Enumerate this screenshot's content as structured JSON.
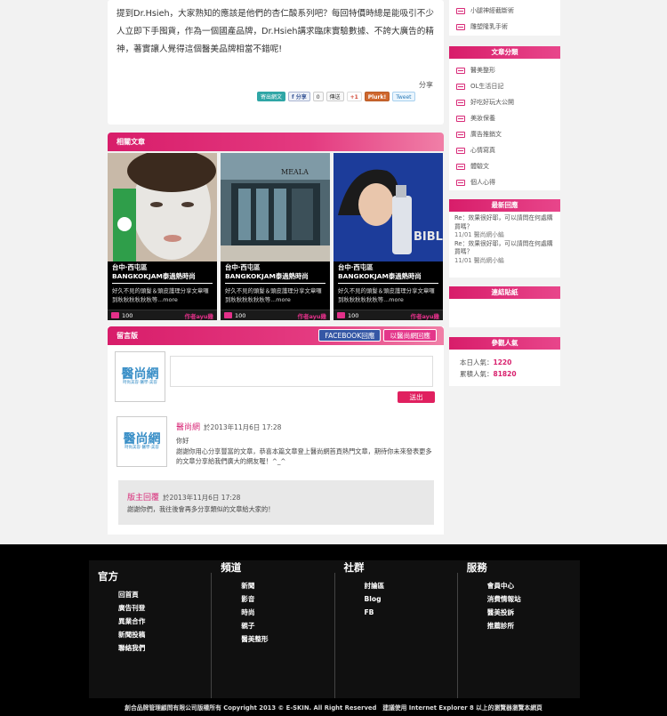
{
  "article": {
    "paragraph": "提到Dr.Hsieh，大家熟知的應該是他們的杏仁酸系列吧？每回特價時總是能吸引不少人立即下手囤貨，作為一個國產品牌，Dr.Hsieh講求臨床實驗數據、不誇大廣告的精神，著實讓人覺得這個醫美品牌相當不錯呢!",
    "share_label": "分享",
    "share_buttons": {
      "email": "寄出網文",
      "fb": "f 分享",
      "fb_count": "0",
      "send": "傳送",
      "gplus": "+1",
      "plurk": "Plurk!",
      "tweet": "Tweet"
    }
  },
  "related": {
    "title": "相關文章",
    "items": [
      {
        "loc": "台中‧西屯區",
        "name": "BANGKOKJAM泰過熱時尚",
        "excerpt": "好久不見的頭髮＆頭皮護理分享文章囉到秋秋秋秋秋秋等...more",
        "count": "100",
        "author": "作者ayu雞"
      },
      {
        "loc": "台中‧西屯區",
        "name": "BANGKOKJAM泰過熱時尚",
        "excerpt": "好久不見的頭髮＆頭皮護理分享文章囉到秋秋秋秋秋秋等...more",
        "count": "100",
        "author": "作者ayu雞"
      },
      {
        "loc": "台中‧西屯區",
        "name": "BANGKOKJAM泰過熱時尚",
        "excerpt": "好久不見的頭髮＆頭皮護理分享文章囉到秋秋秋秋秋秋等...more",
        "count": "100",
        "author": "作者ayu雞"
      }
    ],
    "img_texts": {
      "meala": "MEALA",
      "bible": "BIBLE"
    }
  },
  "comments": {
    "title": "留言版",
    "tab_fb": "FACEBOOK回應",
    "tab_site": "以醫尚網回應",
    "send": "送出",
    "avatar_logo": "醫尚網",
    "avatar_sub": "時尚美容‧醫學‧美容",
    "entry_name": "醫尚網",
    "entry_time": "於2013年11月6日 17:28",
    "entry_body": "你好\n謝謝你用心分享豐富的文章，恭喜本篇文章登上醫尚網首頁熱門文章，期待你未來發表更多的文章分享給我們廣大的網友喔！^_^",
    "reply_name": "版主回覆",
    "reply_time": "於2013年11月6日 17:28",
    "reply_body": "謝謝你們，我往後會再多分享類似的文章給大家的！"
  },
  "sidebar": {
    "top_items": [
      "小腿神經截斷術",
      "雕塑隆乳手術"
    ],
    "categories_title": "文章分類",
    "categories": [
      "醫美整形",
      "OL生活日記",
      "好吃好玩大公開",
      "美妝保養",
      "廣告推銷文",
      "心情寫真",
      "體驗文",
      "個人心得"
    ],
    "recent_title": "最新回應",
    "recent": [
      {
        "text": "Re：效果很好耶，可以請問在何處購買嗎？",
        "meta": "11/01 醫尚網小編"
      },
      {
        "text": "Re：效果很好耶，可以請問在何處購買嗎？",
        "meta": "11/01 醫尚網小編"
      }
    ],
    "links_title": "連結貼紙",
    "visitors_title": "參觀人氣",
    "today_label": "本日人氣：",
    "today": "1220",
    "total_label": "累積人氣：",
    "total": "81820"
  },
  "footer": {
    "cols": [
      {
        "head": "官方",
        "links": [
          "回首頁",
          "廣告刊登",
          "異業合作",
          "新聞投稿",
          "聯絡我們"
        ]
      },
      {
        "head": "頻道",
        "links": [
          "新聞",
          "影音",
          "時尚",
          "親子",
          "醫美整形"
        ]
      },
      {
        "head": "社群",
        "links": [
          "討論區",
          "Blog",
          "FB"
        ]
      },
      {
        "head": "服務",
        "links": [
          "會員中心",
          "消費情報站",
          "醫美投訴",
          "推薦診所"
        ]
      }
    ],
    "copyright": "創合品牌管理顧問有限公司版權所有 Copyright 2013 © E-SKIN. All Right Reserved　建議使用 Internet Explorer 8 以上的瀏覽器瀏覽本網頁"
  },
  "colors": {
    "accent": "#d81d6a",
    "footer_bg": "#000000"
  }
}
